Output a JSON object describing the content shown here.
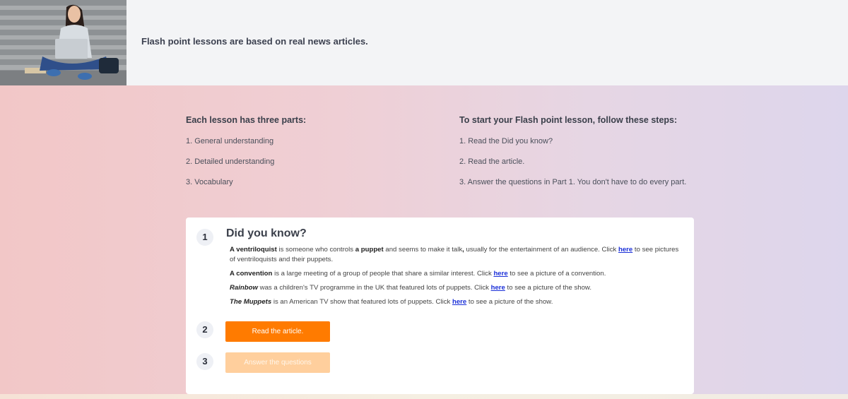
{
  "header": {
    "photo_alt_icon": "person-with-laptop-photo",
    "text": "Flash point lessons are based on real news articles."
  },
  "parts": {
    "heading": "Each lesson has three parts:",
    "items": [
      "1. General understanding",
      "2. Detailed understanding",
      "3. Vocabulary"
    ]
  },
  "steps": {
    "heading": "To start your Flash point lesson, follow these steps:",
    "items": [
      "1. Read the Did you know?",
      "2. Read the article.",
      "3. Answer the questions in Part 1. You don't have to do every part."
    ]
  },
  "card": {
    "step1": {
      "number": "1",
      "title": "Did you know?"
    },
    "facts": [
      {
        "term": "A ventriloquist",
        "before": " is someone who controls ",
        "term2": "a puppet",
        "middle": " and seems to make it talk",
        "bold_comma": ",",
        "after": " usually for the entertainment of an audience. Click ",
        "link": "here",
        "end": " to see pictures of ventriloquists and their puppets."
      },
      {
        "term": "A convention",
        "before": " is a large meeting of a group of people that share a similar interest. Click ",
        "link": "here",
        "end": " to see a picture of a convention."
      },
      {
        "term": "Rainbow",
        "before": " was a children's TV programme in the UK that featured lots of puppets. Click ",
        "link": "here",
        "end": " to see a picture of the show."
      },
      {
        "term": "The Muppets",
        "before": " is an American TV show that featured lots of puppets. Click ",
        "link": "here",
        "end": " to see a picture of the show."
      }
    ],
    "step2": {
      "number": "2",
      "button": "Read the article."
    },
    "step3": {
      "number": "3",
      "button": "Answer the questions"
    }
  },
  "colors": {
    "accent": "#ff7b00",
    "accent_disabled": "#ffcf9d",
    "link": "#1a2fd8"
  }
}
